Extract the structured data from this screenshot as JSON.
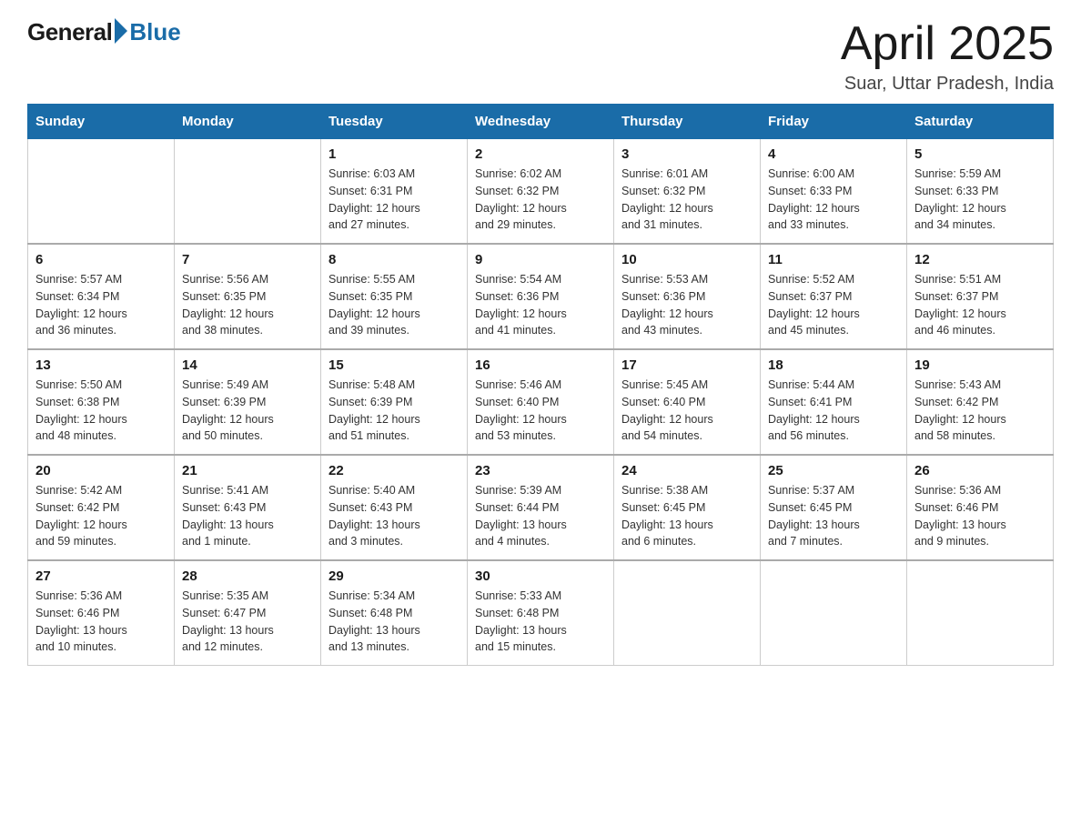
{
  "header": {
    "logo_general": "General",
    "logo_blue": "Blue",
    "month_title": "April 2025",
    "location": "Suar, Uttar Pradesh, India"
  },
  "days_of_week": [
    "Sunday",
    "Monday",
    "Tuesday",
    "Wednesday",
    "Thursday",
    "Friday",
    "Saturday"
  ],
  "weeks": [
    [
      {
        "day": "",
        "info": ""
      },
      {
        "day": "",
        "info": ""
      },
      {
        "day": "1",
        "info": "Sunrise: 6:03 AM\nSunset: 6:31 PM\nDaylight: 12 hours\nand 27 minutes."
      },
      {
        "day": "2",
        "info": "Sunrise: 6:02 AM\nSunset: 6:32 PM\nDaylight: 12 hours\nand 29 minutes."
      },
      {
        "day": "3",
        "info": "Sunrise: 6:01 AM\nSunset: 6:32 PM\nDaylight: 12 hours\nand 31 minutes."
      },
      {
        "day": "4",
        "info": "Sunrise: 6:00 AM\nSunset: 6:33 PM\nDaylight: 12 hours\nand 33 minutes."
      },
      {
        "day": "5",
        "info": "Sunrise: 5:59 AM\nSunset: 6:33 PM\nDaylight: 12 hours\nand 34 minutes."
      }
    ],
    [
      {
        "day": "6",
        "info": "Sunrise: 5:57 AM\nSunset: 6:34 PM\nDaylight: 12 hours\nand 36 minutes."
      },
      {
        "day": "7",
        "info": "Sunrise: 5:56 AM\nSunset: 6:35 PM\nDaylight: 12 hours\nand 38 minutes."
      },
      {
        "day": "8",
        "info": "Sunrise: 5:55 AM\nSunset: 6:35 PM\nDaylight: 12 hours\nand 39 minutes."
      },
      {
        "day": "9",
        "info": "Sunrise: 5:54 AM\nSunset: 6:36 PM\nDaylight: 12 hours\nand 41 minutes."
      },
      {
        "day": "10",
        "info": "Sunrise: 5:53 AM\nSunset: 6:36 PM\nDaylight: 12 hours\nand 43 minutes."
      },
      {
        "day": "11",
        "info": "Sunrise: 5:52 AM\nSunset: 6:37 PM\nDaylight: 12 hours\nand 45 minutes."
      },
      {
        "day": "12",
        "info": "Sunrise: 5:51 AM\nSunset: 6:37 PM\nDaylight: 12 hours\nand 46 minutes."
      }
    ],
    [
      {
        "day": "13",
        "info": "Sunrise: 5:50 AM\nSunset: 6:38 PM\nDaylight: 12 hours\nand 48 minutes."
      },
      {
        "day": "14",
        "info": "Sunrise: 5:49 AM\nSunset: 6:39 PM\nDaylight: 12 hours\nand 50 minutes."
      },
      {
        "day": "15",
        "info": "Sunrise: 5:48 AM\nSunset: 6:39 PM\nDaylight: 12 hours\nand 51 minutes."
      },
      {
        "day": "16",
        "info": "Sunrise: 5:46 AM\nSunset: 6:40 PM\nDaylight: 12 hours\nand 53 minutes."
      },
      {
        "day": "17",
        "info": "Sunrise: 5:45 AM\nSunset: 6:40 PM\nDaylight: 12 hours\nand 54 minutes."
      },
      {
        "day": "18",
        "info": "Sunrise: 5:44 AM\nSunset: 6:41 PM\nDaylight: 12 hours\nand 56 minutes."
      },
      {
        "day": "19",
        "info": "Sunrise: 5:43 AM\nSunset: 6:42 PM\nDaylight: 12 hours\nand 58 minutes."
      }
    ],
    [
      {
        "day": "20",
        "info": "Sunrise: 5:42 AM\nSunset: 6:42 PM\nDaylight: 12 hours\nand 59 minutes."
      },
      {
        "day": "21",
        "info": "Sunrise: 5:41 AM\nSunset: 6:43 PM\nDaylight: 13 hours\nand 1 minute."
      },
      {
        "day": "22",
        "info": "Sunrise: 5:40 AM\nSunset: 6:43 PM\nDaylight: 13 hours\nand 3 minutes."
      },
      {
        "day": "23",
        "info": "Sunrise: 5:39 AM\nSunset: 6:44 PM\nDaylight: 13 hours\nand 4 minutes."
      },
      {
        "day": "24",
        "info": "Sunrise: 5:38 AM\nSunset: 6:45 PM\nDaylight: 13 hours\nand 6 minutes."
      },
      {
        "day": "25",
        "info": "Sunrise: 5:37 AM\nSunset: 6:45 PM\nDaylight: 13 hours\nand 7 minutes."
      },
      {
        "day": "26",
        "info": "Sunrise: 5:36 AM\nSunset: 6:46 PM\nDaylight: 13 hours\nand 9 minutes."
      }
    ],
    [
      {
        "day": "27",
        "info": "Sunrise: 5:36 AM\nSunset: 6:46 PM\nDaylight: 13 hours\nand 10 minutes."
      },
      {
        "day": "28",
        "info": "Sunrise: 5:35 AM\nSunset: 6:47 PM\nDaylight: 13 hours\nand 12 minutes."
      },
      {
        "day": "29",
        "info": "Sunrise: 5:34 AM\nSunset: 6:48 PM\nDaylight: 13 hours\nand 13 minutes."
      },
      {
        "day": "30",
        "info": "Sunrise: 5:33 AM\nSunset: 6:48 PM\nDaylight: 13 hours\nand 15 minutes."
      },
      {
        "day": "",
        "info": ""
      },
      {
        "day": "",
        "info": ""
      },
      {
        "day": "",
        "info": ""
      }
    ]
  ]
}
